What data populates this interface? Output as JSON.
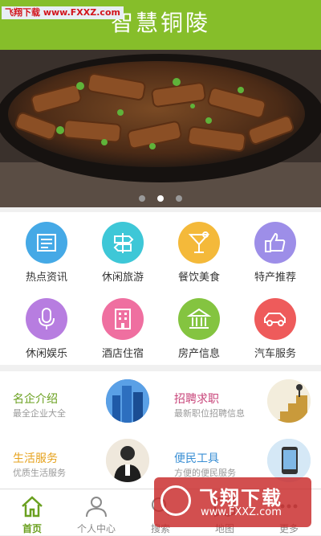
{
  "header": {
    "title": "智慧铜陵",
    "watermark": "飞翔下载 www.FXXZ.com"
  },
  "banner": {
    "dots": 3,
    "active_dot": 2
  },
  "grid": [
    {
      "label": "热点资讯",
      "color": "#45a9e6",
      "icon": "newspaper-icon"
    },
    {
      "label": "休闲旅游",
      "color": "#3ec7d7",
      "icon": "signpost-icon"
    },
    {
      "label": "餐饮美食",
      "color": "#f4b93a",
      "icon": "cocktail-icon"
    },
    {
      "label": "特产推荐",
      "color": "#9d8ee8",
      "icon": "thumbs-up-icon"
    },
    {
      "label": "休闲娱乐",
      "color": "#b77de0",
      "icon": "microphone-icon"
    },
    {
      "label": "酒店住宿",
      "color": "#ef6fa0",
      "icon": "hotel-icon"
    },
    {
      "label": "房产信息",
      "color": "#84c440",
      "icon": "building-icon"
    },
    {
      "label": "汽车服务",
      "color": "#ee5b5b",
      "icon": "car-icon"
    }
  ],
  "cards": [
    {
      "title": "名企介绍",
      "subtitle": "最全企业大全",
      "color": "#6aa01f"
    },
    {
      "title": "招聘求职",
      "subtitle": "最新职位招聘信息",
      "color": "#c8457a"
    },
    {
      "title": "生活服务",
      "subtitle": "优质生活服务",
      "color": "#e6a21c"
    },
    {
      "title": "便民工具",
      "subtitle": "方便的便民服务",
      "color": "#3a8fd4"
    }
  ],
  "tabs": [
    {
      "label": "首页",
      "active": true
    },
    {
      "label": "个人中心",
      "active": false
    },
    {
      "label": "搜索",
      "active": false
    },
    {
      "label": "地图",
      "active": false
    },
    {
      "label": "更多",
      "active": false
    }
  ],
  "watermark2": {
    "brand": "飞翔下载",
    "url": "www.FXXZ.com"
  }
}
